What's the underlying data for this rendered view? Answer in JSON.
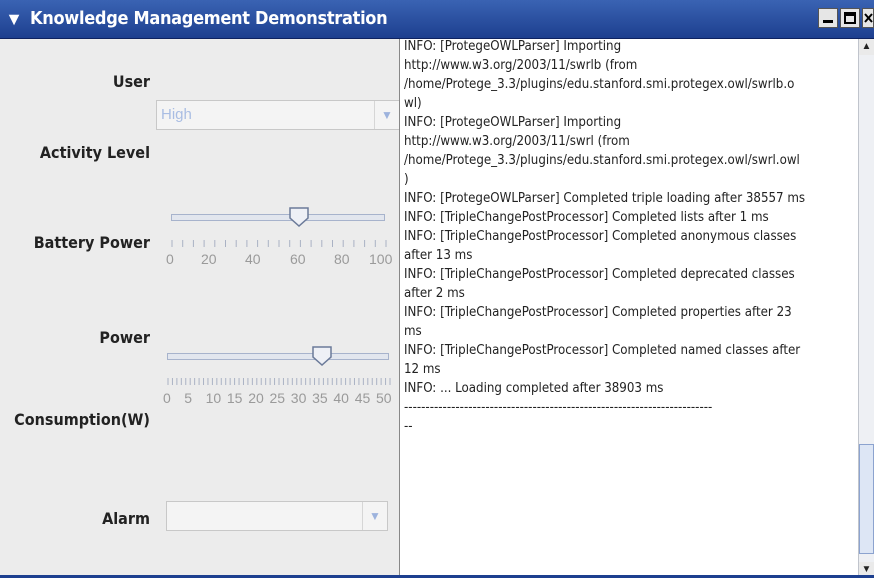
{
  "window": {
    "title": "Knowledge Management Demonstration",
    "menu_icon": "chevron-down-icon",
    "minimize_icon": "minimize-icon",
    "maximize_icon": "maximize-icon",
    "close_icon": "close-icon"
  },
  "form": {
    "user_label": "User",
    "activity_label": "Activity Level",
    "activity_value": "High",
    "battery_label": "Battery Power",
    "battery_slider": {
      "min": 0,
      "max": 100,
      "value": 62,
      "ticks": [
        "0",
        "20",
        "40",
        "60",
        "80",
        "100"
      ]
    },
    "power_label_1": "Power",
    "power_label_2": "Consumption(W)",
    "power_slider": {
      "min": 0,
      "max": 50,
      "value": 36,
      "ticks": [
        "0",
        "5",
        "10",
        "15",
        "20",
        "25",
        "30",
        "35",
        "40",
        "45",
        "50"
      ]
    },
    "alarm_label": "Alarm",
    "alarm_value": ""
  },
  "log": {
    "lines": [
      "INFO: [ProtegeOWLParser] Importing",
      "http://www.w3.org/2003/11/swrlb (from",
      "/home/Protege_3.3/plugins/edu.stanford.smi.protegex.owl/swrlb.o",
      "wl)",
      "INFO: [ProtegeOWLParser] Importing",
      "http://www.w3.org/2003/11/swrl (from",
      "/home/Protege_3.3/plugins/edu.stanford.smi.protegex.owl/swrl.owl",
      ")",
      "INFO: [ProtegeOWLParser] Completed triple loading after 38557 ms",
      "INFO: [TripleChangePostProcessor] Completed lists after 1 ms",
      "INFO: [TripleChangePostProcessor] Completed anonymous classes",
      "after 13 ms",
      "INFO: [TripleChangePostProcessor] Completed deprecated classes",
      "after 2 ms",
      "INFO: [TripleChangePostProcessor] Completed properties after 23",
      "ms",
      "INFO: [TripleChangePostProcessor] Completed named classes after",
      "12 ms",
      "INFO: ... Loading completed after 38903 ms",
      "------------------------------------------------------------------------",
      "",
      "--"
    ]
  }
}
